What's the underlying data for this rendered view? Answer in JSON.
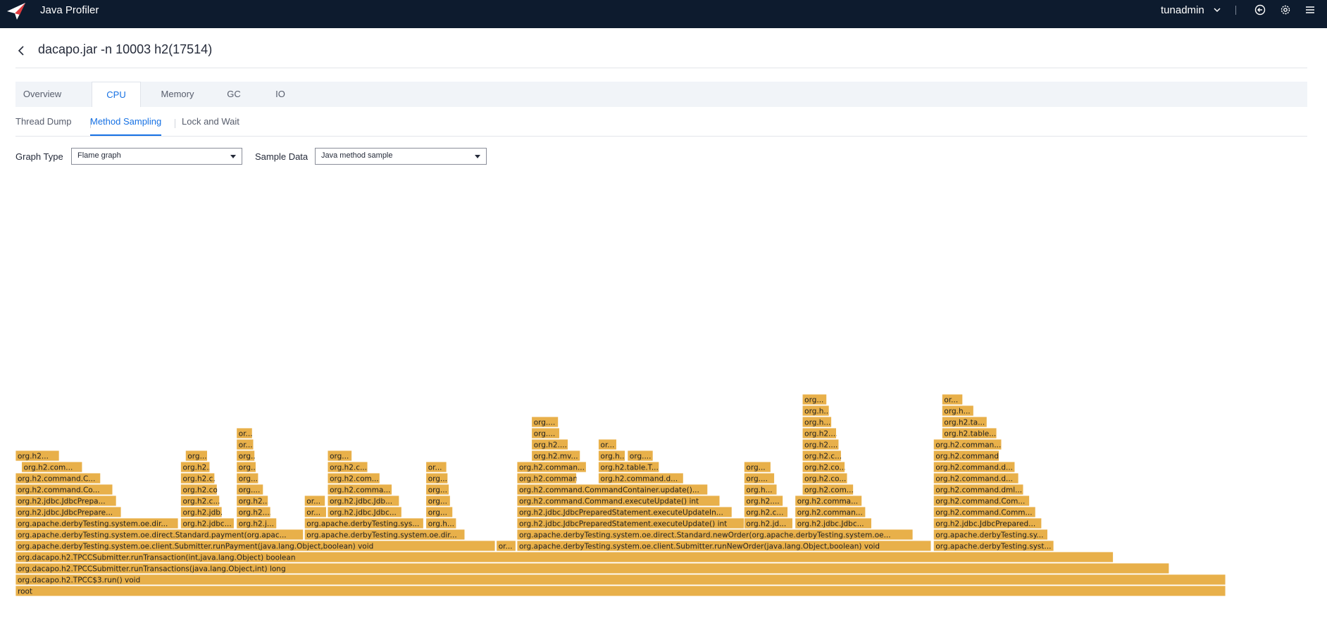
{
  "app": {
    "title": "Java Profiler",
    "user": "tunadmin"
  },
  "page": {
    "title": "dacapo.jar -n 10003 h2(17514)"
  },
  "tabs": [
    "Overview",
    "CPU",
    "Memory",
    "GC",
    "IO"
  ],
  "active_tab": "CPU",
  "subtabs": [
    "Thread Dump",
    "Method Sampling",
    "Lock and Wait"
  ],
  "active_subtab": "Method Sampling",
  "controls": {
    "graph_type_label": "Graph Type",
    "graph_type_value": "Flame graph",
    "sample_data_label": "Sample Data",
    "sample_data_value": "Java method sample"
  },
  "icons": {
    "logo": "profiler-logo-icon",
    "user_menu": "chevron-down-icon",
    "logout": "logout-icon",
    "settings": "gear-icon",
    "menu": "hamburger-menu-icon",
    "back": "back-arrow-icon"
  },
  "colors": {
    "topbar": "#0d1b2e",
    "accent": "#1671e4",
    "frame": "#e8b04a",
    "frame_border": "#ffffff"
  },
  "flame_frames": [
    {
      "label": "root",
      "start": 0,
      "end": 0.9965,
      "depth": 0
    },
    {
      "label": "org.dacapo.h2.TPCC$3.run() void",
      "start": 0,
      "end": 0.9965,
      "depth": 1
    },
    {
      "label": "org.dacapo.h2.TPCCSubmitter.runTransactions(java.lang.Object,int) long",
      "start": 0,
      "end": 0.95,
      "depth": 2
    },
    {
      "label": "org.dacapo.h2.TPCCSubmitter.runTransaction(int,java.lang.Object) boolean",
      "start": 0,
      "end": 0.904,
      "depth": 3
    },
    {
      "label": "org.apache.derbyTesting.system.oe.client.Submitter.runPayment(java.lang.Object,boolean) void",
      "start": 0,
      "end": 0.395,
      "depth": 4
    },
    {
      "label": "or...",
      "start": 0.396,
      "end": 0.412,
      "depth": 4
    },
    {
      "label": "org.apache.derbyTesting.system.oe.client.Submitter.runNewOrder(java.lang.Object,boolean) void",
      "start": 0.413,
      "end": 0.754,
      "depth": 4
    },
    {
      "label": "org.apache.derbyTesting.system.oe.direct.Standard.payment(org.apac...",
      "start": 0,
      "end": 0.237,
      "depth": 5
    },
    {
      "label": "org.apache.derbyTesting.system.oe.dir...",
      "start": 0.238,
      "end": 0.37,
      "depth": 5
    },
    {
      "label": "org.apache.derbyTesting.system.oe.direct.Standard.newOrder(org.apache.derbyTesting.system.oe...",
      "start": 0.413,
      "end": 0.739,
      "depth": 5
    },
    {
      "label": "org.apache.derbyTesting.system.oe.dir...",
      "start": 0,
      "end": 0.134,
      "depth": 6
    },
    {
      "label": "org.h2.jdbc.JdbcPrepare...",
      "start": 0,
      "end": 0.087,
      "depth": 7
    },
    {
      "label": "org.h2.jdbc.JdbcPrepa...",
      "start": 0,
      "end": 0.083,
      "depth": 8
    },
    {
      "label": "org.h2.command.Co...",
      "start": 0,
      "end": 0.08,
      "depth": 9
    },
    {
      "label": "org.h2.command.C...",
      "start": 0,
      "end": 0.07,
      "depth": 10
    },
    {
      "label": "org.h2.com...",
      "start": 0.005,
      "end": 0.055,
      "depth": 11
    },
    {
      "label": "org.h2...",
      "start": 0,
      "end": 0.036,
      "depth": 12
    },
    {
      "label": "org.h2.jdbc...",
      "start": 0.136,
      "end": 0.18,
      "depth": 6
    },
    {
      "label": "org.h2.jdb...",
      "start": 0.136,
      "end": 0.17,
      "depth": 7
    },
    {
      "label": "org.h2.c...",
      "start": 0.136,
      "end": 0.168,
      "depth": 8
    },
    {
      "label": "org.h2.co...",
      "start": 0.136,
      "end": 0.166,
      "depth": 9
    },
    {
      "label": "org.h2.c...",
      "start": 0.136,
      "end": 0.164,
      "depth": 10
    },
    {
      "label": "org.h2....",
      "start": 0.136,
      "end": 0.16,
      "depth": 11
    },
    {
      "label": "org...",
      "start": 0.14,
      "end": 0.158,
      "depth": 12
    },
    {
      "label": "org.h2.j...",
      "start": 0.182,
      "end": 0.215,
      "depth": 6
    },
    {
      "label": "org.h2....",
      "start": 0.182,
      "end": 0.21,
      "depth": 7
    },
    {
      "label": "org.h2....",
      "start": 0.182,
      "end": 0.208,
      "depth": 8
    },
    {
      "label": "org....",
      "start": 0.182,
      "end": 0.204,
      "depth": 9
    },
    {
      "label": "org...",
      "start": 0.182,
      "end": 0.2,
      "depth": 10
    },
    {
      "label": "org...",
      "start": 0.182,
      "end": 0.198,
      "depth": 11
    },
    {
      "label": "org...",
      "start": 0.182,
      "end": 0.197,
      "depth": 12
    },
    {
      "label": "or...",
      "start": 0.182,
      "end": 0.196,
      "depth": 13
    },
    {
      "label": "or...",
      "start": 0.182,
      "end": 0.195,
      "depth": 14
    },
    {
      "label": "org.apache.derbyTesting.sys...",
      "start": 0.238,
      "end": 0.336,
      "depth": 6
    },
    {
      "label": "org.h2.jdbc.Jdbc...",
      "start": 0.257,
      "end": 0.318,
      "depth": 7
    },
    {
      "label": "org.h2.jdbc.Jdb...",
      "start": 0.257,
      "end": 0.316,
      "depth": 8
    },
    {
      "label": "org.h2.comma...",
      "start": 0.257,
      "end": 0.31,
      "depth": 9
    },
    {
      "label": "org.h2.com...",
      "start": 0.257,
      "end": 0.3,
      "depth": 10
    },
    {
      "label": "org.h2.c...",
      "start": 0.257,
      "end": 0.29,
      "depth": 11
    },
    {
      "label": "org...",
      "start": 0.257,
      "end": 0.277,
      "depth": 12
    },
    {
      "label": "or...",
      "start": 0.238,
      "end": 0.256,
      "depth": 7
    },
    {
      "label": "or...",
      "start": 0.238,
      "end": 0.255,
      "depth": 8
    },
    {
      "label": "org.h...",
      "start": 0.338,
      "end": 0.363,
      "depth": 6
    },
    {
      "label": "org...",
      "start": 0.338,
      "end": 0.36,
      "depth": 7
    },
    {
      "label": "org...",
      "start": 0.338,
      "end": 0.358,
      "depth": 8
    },
    {
      "label": "org...",
      "start": 0.338,
      "end": 0.357,
      "depth": 9
    },
    {
      "label": "org...",
      "start": 0.338,
      "end": 0.356,
      "depth": 10
    },
    {
      "label": "or...",
      "start": 0.338,
      "end": 0.355,
      "depth": 11
    },
    {
      "label": "org.h2.jdbc.JdbcPreparedStatement.executeUpdate() int",
      "start": 0.413,
      "end": 0.6,
      "depth": 6
    },
    {
      "label": "org.h2.jdbc.JdbcPreparedStatement.executeUpdateIn...",
      "start": 0.413,
      "end": 0.59,
      "depth": 7
    },
    {
      "label": "org.h2.command.Command.executeUpdate() int",
      "start": 0.413,
      "end": 0.58,
      "depth": 8
    },
    {
      "label": "org.h2.command.CommandContainer.update()...",
      "start": 0.413,
      "end": 0.57,
      "depth": 9
    },
    {
      "label": "org.h2.command.d...",
      "start": 0.48,
      "end": 0.55,
      "depth": 10
    },
    {
      "label": "org.h2.table.T...",
      "start": 0.48,
      "end": 0.53,
      "depth": 11
    },
    {
      "label": "org.h...",
      "start": 0.48,
      "end": 0.502,
      "depth": 12
    },
    {
      "label": "org....",
      "start": 0.504,
      "end": 0.525,
      "depth": 12
    },
    {
      "label": "or...",
      "start": 0.48,
      "end": 0.495,
      "depth": 13
    },
    {
      "label": "org.h2.command...",
      "start": 0.413,
      "end": 0.462,
      "depth": 10
    },
    {
      "label": "org.h2.comman...",
      "start": 0.413,
      "end": 0.47,
      "depth": 11
    },
    {
      "label": "org.h2.mv...",
      "start": 0.425,
      "end": 0.465,
      "depth": 12
    },
    {
      "label": "org.h2....",
      "start": 0.425,
      "end": 0.455,
      "depth": 13
    },
    {
      "label": "org....",
      "start": 0.425,
      "end": 0.448,
      "depth": 14
    },
    {
      "label": "org....",
      "start": 0.425,
      "end": 0.447,
      "depth": 15
    },
    {
      "label": "org.h2.jd...",
      "start": 0.6,
      "end": 0.64,
      "depth": 6
    },
    {
      "label": "org.h2.c...",
      "start": 0.6,
      "end": 0.636,
      "depth": 7
    },
    {
      "label": "org.h2....",
      "start": 0.6,
      "end": 0.632,
      "depth": 8
    },
    {
      "label": "org.h...",
      "start": 0.6,
      "end": 0.627,
      "depth": 9
    },
    {
      "label": "org....",
      "start": 0.6,
      "end": 0.625,
      "depth": 10
    },
    {
      "label": "org...",
      "start": 0.6,
      "end": 0.622,
      "depth": 11
    },
    {
      "label": "org.h2.jdbc.Jdbc...",
      "start": 0.642,
      "end": 0.705,
      "depth": 6
    },
    {
      "label": "org.h2.comman...",
      "start": 0.642,
      "end": 0.7,
      "depth": 7
    },
    {
      "label": "org.h2.comma...",
      "start": 0.642,
      "end": 0.697,
      "depth": 8
    },
    {
      "label": "org.h2.com...",
      "start": 0.648,
      "end": 0.69,
      "depth": 9
    },
    {
      "label": "org.h2.co...",
      "start": 0.648,
      "end": 0.685,
      "depth": 10
    },
    {
      "label": "org.h2.co...",
      "start": 0.648,
      "end": 0.683,
      "depth": 11
    },
    {
      "label": "org.h2.c...",
      "start": 0.648,
      "end": 0.68,
      "depth": 12
    },
    {
      "label": "org.h2....",
      "start": 0.648,
      "end": 0.678,
      "depth": 13
    },
    {
      "label": "org.h2....",
      "start": 0.648,
      "end": 0.676,
      "depth": 14
    },
    {
      "label": "org.h...",
      "start": 0.648,
      "end": 0.672,
      "depth": 15
    },
    {
      "label": "org.h...",
      "start": 0.648,
      "end": 0.67,
      "depth": 16
    },
    {
      "label": "org...",
      "start": 0.648,
      "end": 0.668,
      "depth": 17
    },
    {
      "label": "org.apache.derbyTesting.syst...",
      "start": 0.756,
      "end": 0.855,
      "depth": 4
    },
    {
      "label": "org.apache.derbyTesting.sy...",
      "start": 0.756,
      "end": 0.85,
      "depth": 5
    },
    {
      "label": "org.h2.jdbc.JdbcPrepared...",
      "start": 0.756,
      "end": 0.845,
      "depth": 6
    },
    {
      "label": "org.h2.command.Comm...",
      "start": 0.756,
      "end": 0.84,
      "depth": 7
    },
    {
      "label": "org.h2.command.Com...",
      "start": 0.756,
      "end": 0.835,
      "depth": 8
    },
    {
      "label": "org.h2.command.dml...",
      "start": 0.756,
      "end": 0.83,
      "depth": 9
    },
    {
      "label": "org.h2.command.d...",
      "start": 0.756,
      "end": 0.826,
      "depth": 10
    },
    {
      "label": "org.h2.command.d...",
      "start": 0.756,
      "end": 0.823,
      "depth": 11
    },
    {
      "label": "org.h2.command...",
      "start": 0.756,
      "end": 0.81,
      "depth": 12
    },
    {
      "label": "org.h2.comman...",
      "start": 0.756,
      "end": 0.812,
      "depth": 13
    },
    {
      "label": "org.h2.table...",
      "start": 0.763,
      "end": 0.808,
      "depth": 14
    },
    {
      "label": "org.h2.ta...",
      "start": 0.763,
      "end": 0.8,
      "depth": 15
    },
    {
      "label": "org.h...",
      "start": 0.763,
      "end": 0.789,
      "depth": 16
    },
    {
      "label": "or...",
      "start": 0.763,
      "end": 0.78,
      "depth": 17
    }
  ]
}
